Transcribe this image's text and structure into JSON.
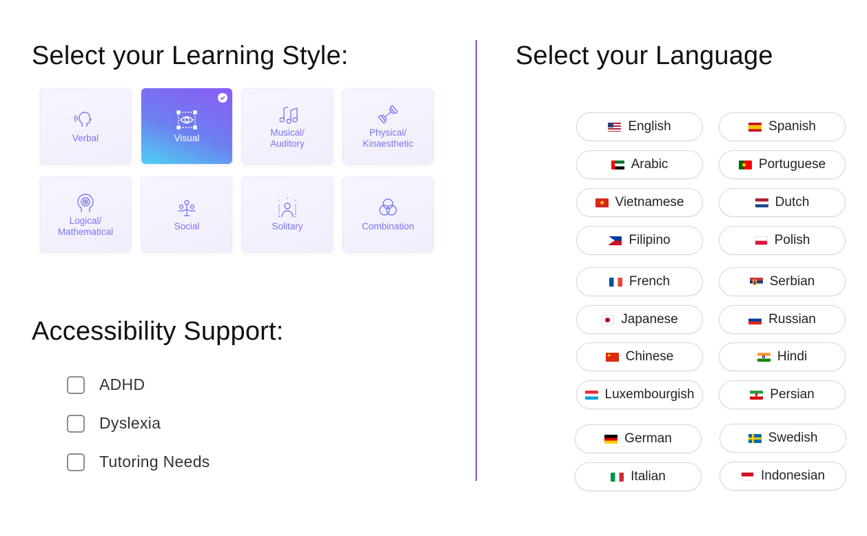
{
  "learning_style": {
    "title": "Select your Learning Style:",
    "cards": [
      {
        "label_lines": [
          "Verbal"
        ],
        "icon": "speaking-head-icon",
        "selected": false
      },
      {
        "label_lines": [
          "Visual"
        ],
        "icon": "eye-icon",
        "selected": true
      },
      {
        "label_lines": [
          "Musical/",
          "Auditory"
        ],
        "icon": "music-notes-icon",
        "selected": false
      },
      {
        "label_lines": [
          "Physical/",
          "Kinaesthetic"
        ],
        "icon": "dumbbell-icon",
        "selected": false
      },
      {
        "label_lines": [
          "Logical/",
          "Mathematical"
        ],
        "icon": "brain-head-icon",
        "selected": false
      },
      {
        "label_lines": [
          "Social"
        ],
        "icon": "people-icon",
        "selected": false
      },
      {
        "label_lines": [
          "Solitary"
        ],
        "icon": "solitary-person-icon",
        "selected": false
      },
      {
        "label_lines": [
          "Combination"
        ],
        "icon": "venn-circles-icon",
        "selected": false
      }
    ]
  },
  "accessibility": {
    "title": "Accessibility Support:",
    "options": [
      {
        "label": "ADHD",
        "checked": false
      },
      {
        "label": "Dyslexia",
        "checked": false
      },
      {
        "label": "Tutoring Needs",
        "checked": false
      }
    ]
  },
  "language": {
    "title": "Select your Language",
    "options": [
      {
        "label": "English",
        "flag": "us-flag-icon"
      },
      {
        "label": "Spanish",
        "flag": "spain-flag-icon"
      },
      {
        "label": "Arabic",
        "flag": "uae-flag-icon"
      },
      {
        "label": "Portuguese",
        "flag": "portugal-flag-icon"
      },
      {
        "label": "Vietnamese",
        "flag": "vietnam-flag-icon"
      },
      {
        "label": "Dutch",
        "flag": "netherlands-flag-icon"
      },
      {
        "label": "Filipino",
        "flag": "philippines-flag-icon"
      },
      {
        "label": "Polish",
        "flag": "poland-flag-icon"
      },
      {
        "label": "French",
        "flag": "france-flag-icon"
      },
      {
        "label": "Serbian",
        "flag": "serbia-flag-icon"
      },
      {
        "label": "Japanese",
        "flag": "japan-flag-icon"
      },
      {
        "label": "Russian",
        "flag": "russia-flag-icon"
      },
      {
        "label": "Chinese",
        "flag": "china-flag-icon"
      },
      {
        "label": "Hindi",
        "flag": "india-flag-icon"
      },
      {
        "label": "Luxembourgish",
        "flag": "luxembourg-flag-icon"
      },
      {
        "label": "Persian",
        "flag": "iran-flag-icon"
      },
      {
        "label": "German",
        "flag": "germany-flag-icon"
      },
      {
        "label": "Swedish",
        "flag": "sweden-flag-icon"
      },
      {
        "label": "Italian",
        "flag": "italy-flag-icon"
      },
      {
        "label": "Indonesian",
        "flag": "indonesia-flag-icon"
      }
    ]
  },
  "colors": {
    "accent": "#7c4dde",
    "selected_gradient_start": "#8a5cf6",
    "selected_gradient_end": "#4ed1f3"
  }
}
